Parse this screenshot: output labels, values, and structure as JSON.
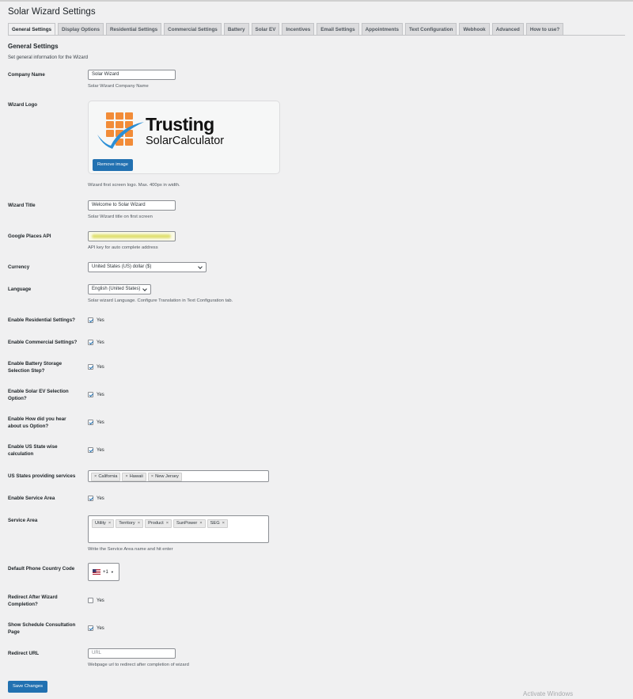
{
  "page": {
    "title": "Solar Wizard Settings",
    "watermark": "Activate Windows"
  },
  "tabs": [
    {
      "label": "General Settings",
      "active": true
    },
    {
      "label": "Display Options"
    },
    {
      "label": "Residential Settings"
    },
    {
      "label": "Commercial Settings"
    },
    {
      "label": "Battery"
    },
    {
      "label": "Solar EV"
    },
    {
      "label": "Incentives"
    },
    {
      "label": "Email Settings"
    },
    {
      "label": "Appointments"
    },
    {
      "label": "Text Configuration"
    },
    {
      "label": "Webhook"
    },
    {
      "label": "Advanced"
    },
    {
      "label": "How to use?"
    }
  ],
  "section": {
    "title": "General Settings",
    "description": "Set general information for the Wizard"
  },
  "company": {
    "label": "Company Name",
    "value": "Solar Wizard",
    "description": "Solar Wizard Company Name"
  },
  "logo": {
    "label": "Wizard Logo",
    "brand_line1": "Trusting",
    "brand_line2": "SolarCalculator",
    "remove_label": "Remove image",
    "description": "Wizard first screen logo. Max. 400px in width."
  },
  "wizard_title": {
    "label": "Wizard Title",
    "value": "Welcome to Solar Wizard",
    "description": "Solar Wizard title on first screen"
  },
  "places_api": {
    "label": "Google Places API",
    "description": "API key for auto complete address"
  },
  "currency": {
    "label": "Currency",
    "value": "United States (US) dollar ($)"
  },
  "language": {
    "label": "Language",
    "value": "English (United States)",
    "description": "Solar wizard Language. Configure Translation in Text Configuration tab."
  },
  "checks": {
    "yes_label": "Yes",
    "residential": "Enable Residential Settings?",
    "commercial": "Enable Commercial Settings?",
    "battery_l1": "Enable Battery Storage",
    "battery_l2": "Selection Step?",
    "ev_l1": "Enable Solar EV Selection",
    "ev_l2": "Option?",
    "hear_l1": "Enable How did you hear",
    "hear_l2": "about us Option?",
    "state_l1": "Enable US State wise",
    "state_l2": "calculation"
  },
  "us_states": {
    "label": "US States providing services",
    "tags": [
      "California",
      "Hawaii",
      "New Jersey"
    ]
  },
  "service_area_enable": {
    "label": "Enable Service Area"
  },
  "service_area": {
    "label": "Service Area",
    "tags": [
      "Utility",
      "Territory",
      "Product",
      "SunPower",
      "SEG"
    ],
    "description": "Write the Service Area name and hit enter"
  },
  "phone": {
    "label": "Default Phone Country Code",
    "code": "+1"
  },
  "redirect_after": {
    "label_l1": "Redirect After Wizard",
    "label_l2": "Completion?"
  },
  "schedule": {
    "label_l1": "Show Schedule Consultation",
    "label_l2": "Page"
  },
  "redirect_url": {
    "label": "Redirect URL",
    "placeholder": "URL",
    "description": "Webpage url to redirect after completion of wizard"
  },
  "save_label": "Save Changes"
}
